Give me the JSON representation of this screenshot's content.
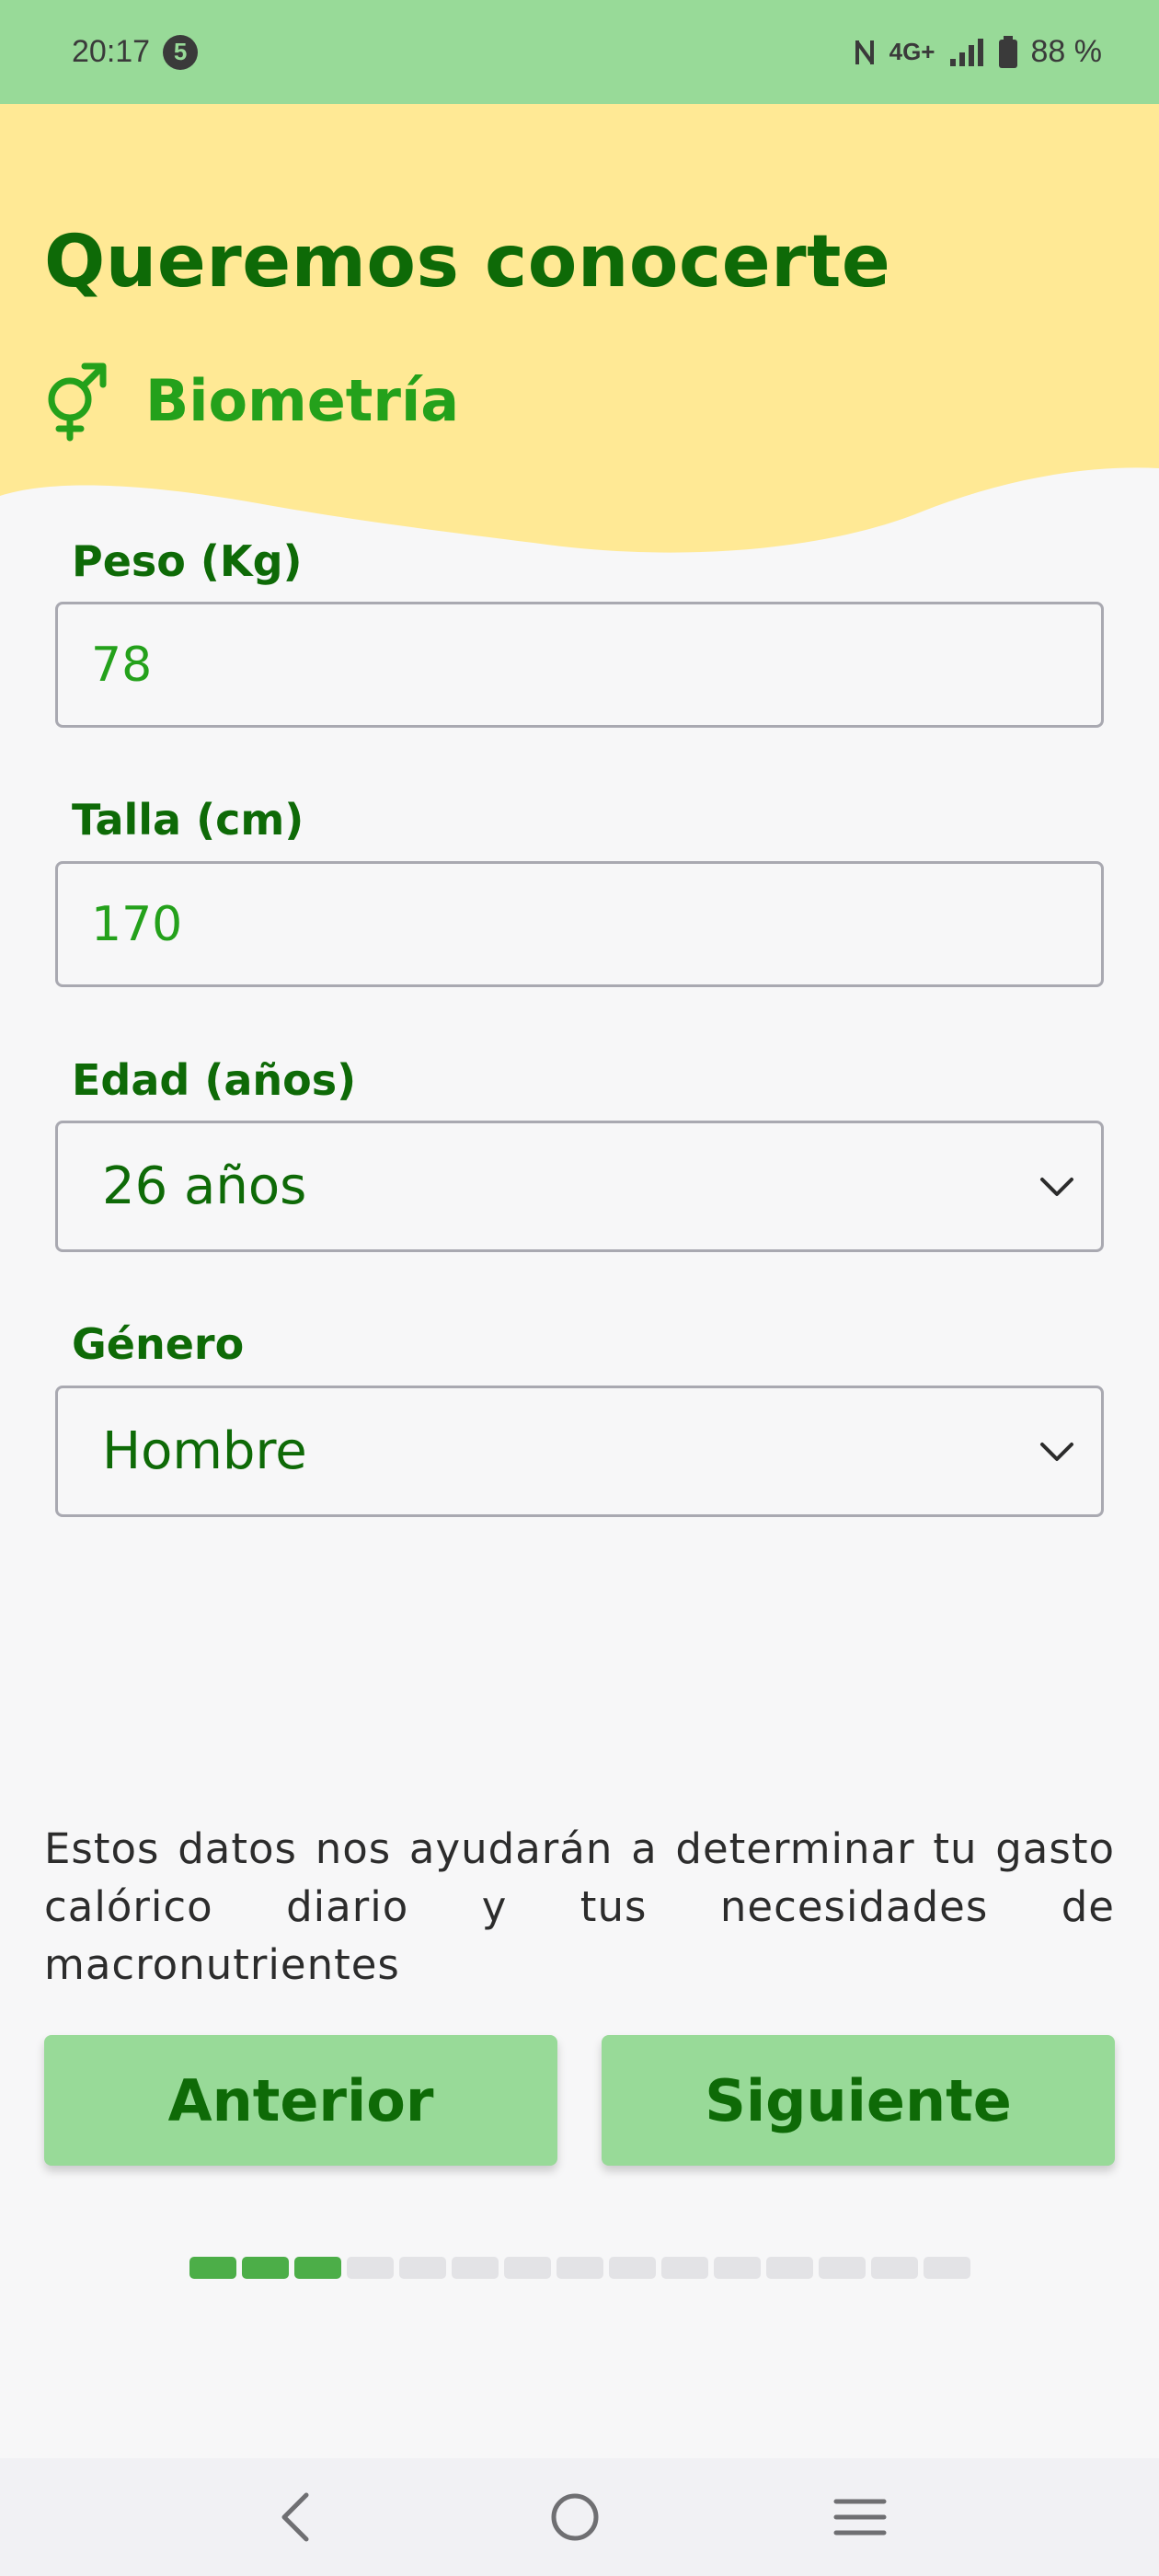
{
  "status_bar": {
    "time": "20:17",
    "notification_count": "5",
    "network": "4G+",
    "battery": "88 %"
  },
  "header": {
    "title": "Queremos conocerte",
    "section_title": "Biometría",
    "section_icon": "gender-icon"
  },
  "form": {
    "weight": {
      "label": "Peso (Kg)",
      "value": "78"
    },
    "height": {
      "label": "Talla (cm)",
      "value": "170"
    },
    "age": {
      "label": "Edad (años)",
      "selected": "26 años"
    },
    "gender": {
      "label": "Género",
      "selected": "Hombre"
    }
  },
  "info_text": "Estos datos nos ayudarán a determinar tu gasto calórico diario y tus necesidades de macronutrientes",
  "buttons": {
    "previous": "Anterior",
    "next": "Siguiente"
  },
  "progress": {
    "completed_steps": 3,
    "total_steps": 15
  },
  "colors": {
    "status_bar": "#98da98",
    "header_bg": "#ffe995",
    "primary_dark": "#0e6a07",
    "primary": "#24a11b",
    "button_bg": "#98da98",
    "progress_done": "#4cae48",
    "progress_todo": "#e3e3e6"
  }
}
